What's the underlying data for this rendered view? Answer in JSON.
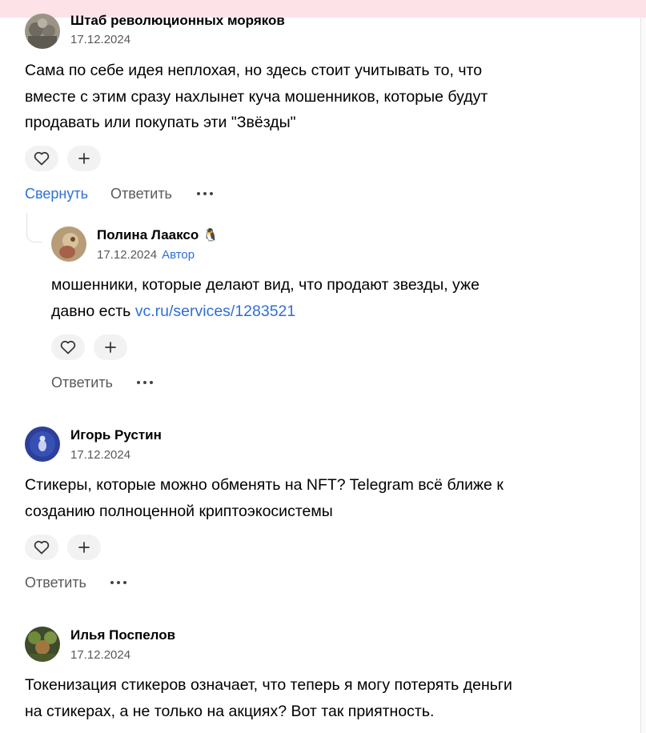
{
  "comments": [
    {
      "author": "Штаб революционных моряков",
      "date": "17.12.2024",
      "lines": [
        "Сама по себе идея неплохая, но здесь стоит учитывать то, что",
        "вместе с этим сразу нахлынет куча мошенников, которые будут",
        "продавать или покупать эти \"Звёзды\""
      ],
      "collapse_label": "Свернуть",
      "reply_label": "Ответить"
    },
    {
      "author": "Полина Лааксо",
      "author_emoji": "🐧",
      "date": "17.12.2024",
      "badge": "Автор",
      "line1": "мошенники, которые делают вид, что продают звезды, уже",
      "line2_prefix": "давно есть ",
      "link_text": "vc.ru/services/1283521",
      "reply_label": "Ответить"
    },
    {
      "author": "Игорь Рустин",
      "date": "17.12.2024",
      "lines": [
        "Стикеры, которые можно обменять на NFT? Telegram всё ближе к",
        "созданию полноценной криптоэкосистемы"
      ],
      "reply_label": "Ответить"
    },
    {
      "author": "Илья Поспелов",
      "date": "17.12.2024",
      "lines": [
        "Токенизация стикеров означает, что теперь я могу потерять деньги",
        "на стикерах, а не только на акциях? Вот так приятность."
      ]
    }
  ],
  "icons": {
    "like": "heart-icon",
    "add_reaction": "plus-icon",
    "more": "more-dots-icon"
  },
  "colors": {
    "link": "#2f6fd6",
    "muted": "#595959",
    "reaction_bg": "#f2f2f2",
    "banner": "#fde2e7"
  }
}
